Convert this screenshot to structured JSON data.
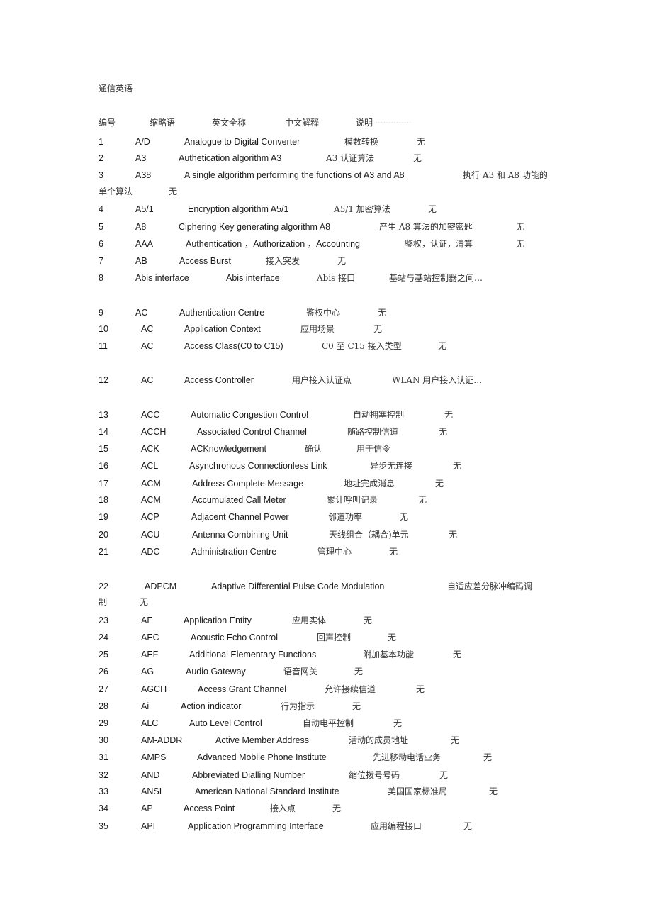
{
  "document": {
    "title": "通信英语",
    "header": {
      "number": "编号",
      "abbr": "缩略语",
      "english": "英文全称",
      "chinese": "中文解释",
      "note": "说明"
    },
    "entries": [
      {
        "no": "1",
        "abbr": "A/D",
        "english": "Analogue to Digital Converter",
        "chinese": "模数转换",
        "note": "无"
      },
      {
        "no": "2",
        "abbr": "A3",
        "english": "Authetication algorithm A3",
        "chinese": "A3 认证算法",
        "note": "无"
      },
      {
        "no": "3",
        "abbr": "A38",
        "english": "A single algorithm performing the functions of A3 and A8",
        "chinese": "执行 A3 和 A8 功能的",
        "chinese_cont": "单个算法",
        "note": "无"
      },
      {
        "no": "4",
        "abbr": "A5/1",
        "english": "Encryption algorithm A5/1",
        "chinese": "A5/1 加密算法",
        "note": "无"
      },
      {
        "no": "5",
        "abbr": "A8",
        "english": "Ciphering Key generating algorithm A8",
        "chinese": "产生 A8 算法的加密密匙",
        "note": "无"
      },
      {
        "no": "6",
        "abbr": "AAA",
        "english": "Authentication ，Authorization ，Accounting",
        "chinese": "鉴权，认证，清算",
        "note": "无"
      },
      {
        "no": "7",
        "abbr": "AB",
        "english": "Access Burst",
        "chinese": "接入突发",
        "note": "无"
      },
      {
        "no": "8",
        "abbr": "Abis interface",
        "english": "Abis interface",
        "chinese": "Abis 接口",
        "note": "基站与基站控制器之间…"
      },
      {
        "no": "9",
        "abbr": "AC",
        "english": "Authentication Centre",
        "chinese": "鉴权中心",
        "note": "无"
      },
      {
        "no": "10",
        "abbr": "AC",
        "english": "Application Context",
        "chinese": "应用场景",
        "note": "无"
      },
      {
        "no": "11",
        "abbr": "AC",
        "english": "Access Class(C0 to C15)",
        "chinese": "C0 至 C15 接入类型",
        "note": "无"
      },
      {
        "no": "12",
        "abbr": "AC",
        "english": "Access Controller",
        "chinese": "用户接入认证点",
        "note": "WLAN 用户接入认证…"
      },
      {
        "no": "13",
        "abbr": "ACC",
        "english": "Automatic Congestion Control",
        "chinese": "自动拥塞控制",
        "note": "无"
      },
      {
        "no": "14",
        "abbr": "ACCH",
        "english": "Associated Control Channel",
        "chinese": "随路控制信道",
        "note": "无"
      },
      {
        "no": "15",
        "abbr": "ACK",
        "english": "ACKnowledgement",
        "chinese": "确认",
        "note": "用于信令"
      },
      {
        "no": "16",
        "abbr": "ACL",
        "english": "Asynchronous Connectionless Link",
        "chinese": "异步无连接",
        "note": "无"
      },
      {
        "no": "17",
        "abbr": "ACM",
        "english": "Address Complete Message",
        "chinese": "地址完成消息",
        "note": "无"
      },
      {
        "no": "18",
        "abbr": "ACM",
        "english": "Accumulated Call Meter",
        "chinese": "累计呼叫记录",
        "note": "无"
      },
      {
        "no": "19",
        "abbr": "ACP",
        "english": "Adjacent Channel Power",
        "chinese": "邻道功率",
        "note": "无"
      },
      {
        "no": "20",
        "abbr": "ACU",
        "english": "Antenna Combining Unit",
        "chinese": "天线组合（耦合)单元",
        "note": "无"
      },
      {
        "no": "21",
        "abbr": "ADC",
        "english": "Administration Centre",
        "chinese": "管理中心",
        "note": "无"
      },
      {
        "no": "22",
        "abbr": "ADPCM",
        "english": "Adaptive   Differential   Pulse   Code   Modulation",
        "chinese": "自适应差分脉冲编码调",
        "chinese_cont": "制",
        "note": "无"
      },
      {
        "no": "23",
        "abbr": "AE",
        "english": "Application Entity",
        "chinese": "应用实体",
        "note": "无"
      },
      {
        "no": "24",
        "abbr": "AEC",
        "english": "Acoustic Echo Control",
        "chinese": "回声控制",
        "note": "无"
      },
      {
        "no": "25",
        "abbr": "AEF",
        "english": "Additional Elementary Functions",
        "chinese": "附加基本功能",
        "note": "无"
      },
      {
        "no": "26",
        "abbr": "AG",
        "english": "Audio Gateway",
        "chinese": "语音网关",
        "note": "无"
      },
      {
        "no": "27",
        "abbr": "AGCH",
        "english": "Access Grant Channel",
        "chinese": "允许接续信道",
        "note": "无"
      },
      {
        "no": "28",
        "abbr": "Ai",
        "english": "Action indicator",
        "chinese": "行为指示",
        "note": "无"
      },
      {
        "no": "29",
        "abbr": "ALC",
        "english": "Auto Level Control",
        "chinese": "自动电平控制",
        "note": "无"
      },
      {
        "no": "30",
        "abbr": "AM-ADDR",
        "english": "Active Member Address",
        "chinese": "活动的成员地址",
        "note": "无"
      },
      {
        "no": "31",
        "abbr": "AMPS",
        "english": "Advanced Mobile Phone Institute",
        "chinese": "先进移动电话业务",
        "note": "无"
      },
      {
        "no": "32",
        "abbr": "AND",
        "english": "Abbreviated Dialling Number",
        "chinese": "缩位拨号号码",
        "note": "无"
      },
      {
        "no": "33",
        "abbr": "ANSI",
        "english": "American National Standard Institute",
        "chinese": "美国国家标准局",
        "note": "无"
      },
      {
        "no": "34",
        "abbr": "AP",
        "english": "Access Point",
        "chinese": "接入点",
        "note": "无"
      },
      {
        "no": "35",
        "abbr": "API",
        "english": "Application Programming Interface",
        "chinese": "应用编程接口",
        "note": "无"
      }
    ]
  }
}
